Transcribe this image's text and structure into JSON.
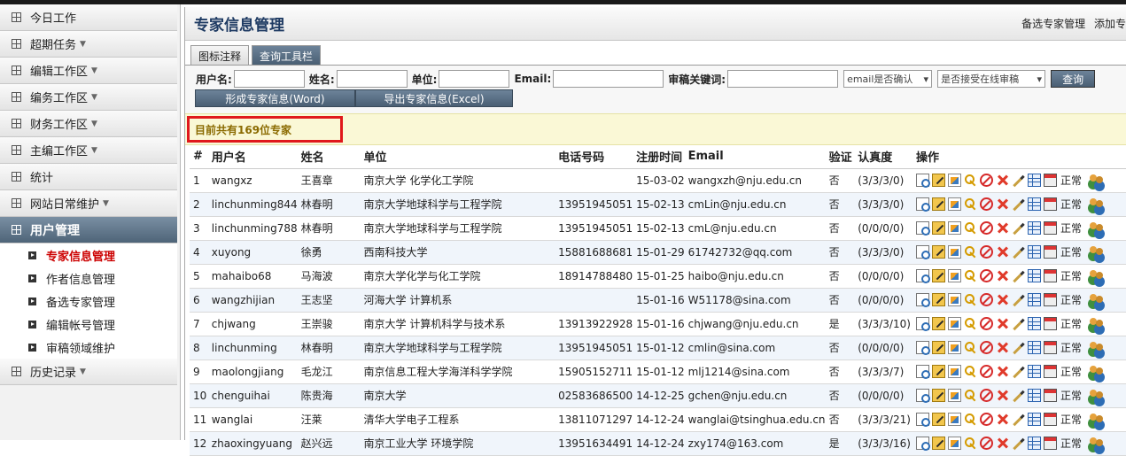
{
  "sidebar": {
    "items": [
      {
        "label": "今日工作",
        "caret": false
      },
      {
        "label": "超期任务",
        "caret": true
      },
      {
        "label": "编辑工作区",
        "caret": true
      },
      {
        "label": "编务工作区",
        "caret": true
      },
      {
        "label": "财务工作区",
        "caret": true
      },
      {
        "label": "主编工作区",
        "caret": true
      },
      {
        "label": "统计",
        "caret": false
      },
      {
        "label": "网站日常维护",
        "caret": true
      }
    ],
    "active_section": {
      "label": "用户管理"
    },
    "sub_items": [
      {
        "label": "专家信息管理"
      },
      {
        "label": "作者信息管理"
      },
      {
        "label": "备选专家管理"
      },
      {
        "label": "编辑帐号管理"
      },
      {
        "label": "审稿领域维护"
      }
    ],
    "history": {
      "label": "历史记录"
    },
    "caret_glyph": "▼"
  },
  "header": {
    "title": "专家信息管理",
    "links": [
      "备选专家管理",
      "添加专"
    ]
  },
  "tabs": [
    "图标注释",
    "查询工具栏"
  ],
  "query": {
    "username_label": "用户名:",
    "name_label": "姓名:",
    "unit_label": "单位:",
    "email_label": "Email:",
    "keyword_label": "审稿关键词:",
    "email_confirm_select": "email是否确认",
    "online_review_select": "是否接受在线审稿",
    "search_button": "查询",
    "word_button": "形成专家信息(Word)",
    "excel_button": "导出专家信息(Excel)"
  },
  "summary": {
    "text": "目前共有169位专家"
  },
  "table": {
    "headers": [
      "#",
      "用户名",
      "姓名",
      "单位",
      "电话号码",
      "注册时间",
      "Email",
      "验证",
      "认真度",
      "操作"
    ],
    "status_label": "正常",
    "rows": [
      [
        "1",
        "wangxz",
        "王喜章",
        "南京大学 化学化工学院",
        "",
        "15-03-02",
        "wangxzh@nju.edu.cn",
        "否",
        "(3/3/3/0)"
      ],
      [
        "2",
        "linchunming844",
        "林春明",
        "南京大学地球科学与工程学院",
        "13951945051",
        "15-02-13",
        "cmLin@nju.edu.cn",
        "否",
        "(3/3/3/0)"
      ],
      [
        "3",
        "linchunming788",
        "林春明",
        "南京大学地球科学与工程学院",
        "13951945051",
        "15-02-13",
        "cmL@nju.edu.cn",
        "否",
        "(0/0/0/0)"
      ],
      [
        "4",
        "xuyong",
        "徐勇",
        "西南科技大学",
        "15881688681",
        "15-01-29",
        "61742732@qq.com",
        "否",
        "(3/3/3/0)"
      ],
      [
        "5",
        "mahaibo68",
        "马海波",
        "南京大学化学与化工学院",
        "18914788480",
        "15-01-25",
        "haibo@nju.edu.cn",
        "否",
        "(0/0/0/0)"
      ],
      [
        "6",
        "wangzhijian",
        "王志坚",
        "河海大学 计算机系",
        "",
        "15-01-16",
        "W51178@sina.com",
        "否",
        "(0/0/0/0)"
      ],
      [
        "7",
        "chjwang",
        "王崇骏",
        "南京大学 计算机科学与技术系",
        "13913922928",
        "15-01-16",
        "chjwang@nju.edu.cn",
        "是",
        "(3/3/3/10)"
      ],
      [
        "8",
        "linchunming",
        "林春明",
        "南京大学地球科学与工程学院",
        "13951945051",
        "15-01-12",
        "cmlin@sina.com",
        "否",
        "(0/0/0/0)"
      ],
      [
        "9",
        "maolongjiang",
        "毛龙江",
        "南京信息工程大学海洋科学学院",
        "15905152711",
        "15-01-12",
        "mlj1214@sina.com",
        "否",
        "(3/3/3/7)"
      ],
      [
        "10",
        "chenguihai",
        "陈贵海",
        "南京大学",
        "02583686500",
        "14-12-25",
        "gchen@nju.edu.cn",
        "否",
        "(0/0/0/0)"
      ],
      [
        "11",
        "wanglai",
        "汪莱",
        "清华大学电子工程系",
        "13811071297",
        "14-12-24",
        "wanglai@tsinghua.edu.cn",
        "否",
        "(3/3/3/21)"
      ],
      [
        "12",
        "zhaoxingyuang",
        "赵兴远",
        "南京工业大学 环境学院",
        "13951634491",
        "14-12-24",
        "zxy174@163.com",
        "是",
        "(3/3/3/16)"
      ]
    ]
  }
}
